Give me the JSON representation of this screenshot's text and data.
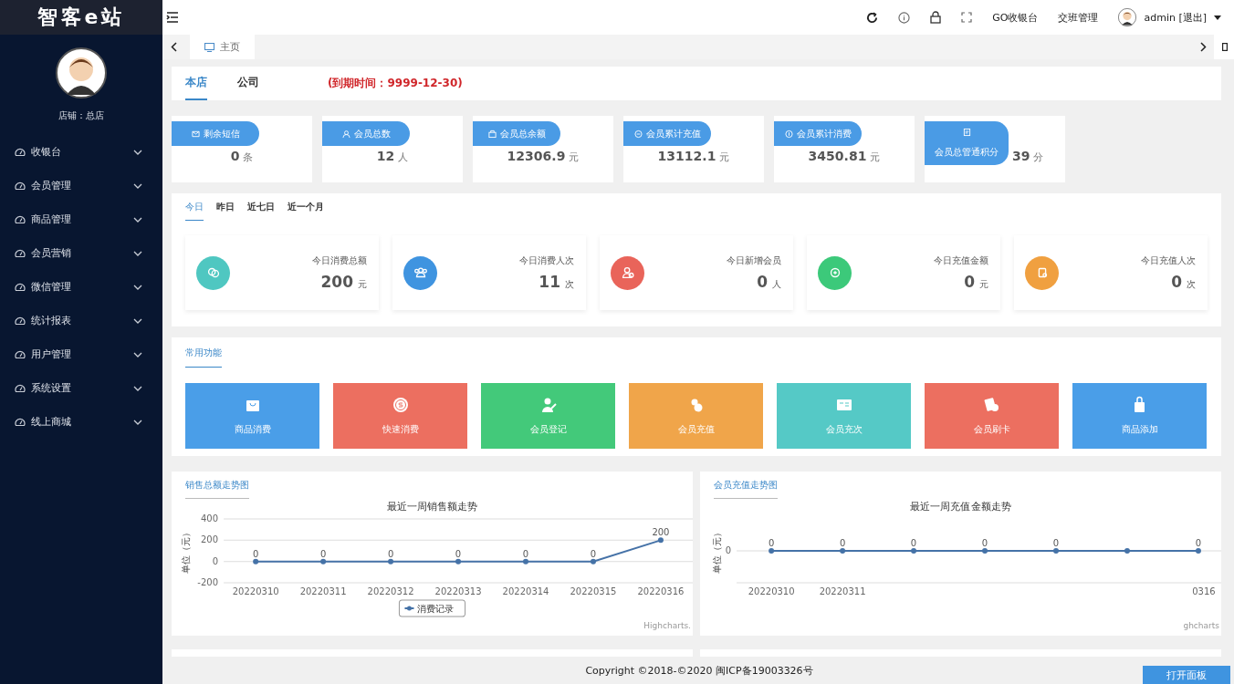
{
  "brand": {
    "title": "智客e站"
  },
  "sidebar": {
    "store_label": "店铺：总店",
    "items": [
      {
        "label": "收银台"
      },
      {
        "label": "会员管理"
      },
      {
        "label": "商品管理"
      },
      {
        "label": "会员营销"
      },
      {
        "label": "微信管理"
      },
      {
        "label": "统计报表"
      },
      {
        "label": "用户管理"
      },
      {
        "label": "系统设置"
      },
      {
        "label": "线上商城"
      }
    ]
  },
  "topbar": {
    "links": [
      "GO收银台",
      "交班管理"
    ],
    "user": "admin [退出]"
  },
  "tabs": [
    {
      "label": "主页",
      "selected": true
    }
  ],
  "store_tabs": {
    "tabs": [
      {
        "label": "本店",
        "selected": true
      },
      {
        "label": "公司",
        "selected": false
      }
    ],
    "expiry": "(到期时间：9999-12-30)"
  },
  "summary_cards": [
    {
      "label": "剩余短信",
      "value": "0",
      "unit": "条"
    },
    {
      "label": "会员总数",
      "value": "12",
      "unit": "人"
    },
    {
      "label": "会员总余额",
      "value": "12306.9",
      "unit": "元"
    },
    {
      "label": "会员累计充值",
      "value": "13112.1",
      "unit": "元"
    },
    {
      "label": "会员累计消费",
      "value": "3450.81",
      "unit": "元"
    },
    {
      "label": "会员总管通积分",
      "value": "39",
      "unit": "分"
    }
  ],
  "period_tabs": [
    {
      "label": "今日",
      "selected": true
    },
    {
      "label": "昨日",
      "selected": false
    },
    {
      "label": "近七日",
      "selected": false
    },
    {
      "label": "近一个月",
      "selected": false
    }
  ],
  "today_stats": [
    {
      "label": "今日消费总额",
      "value": "200",
      "unit": "元",
      "color": "#4fc7c1"
    },
    {
      "label": "今日消费人次",
      "value": "11",
      "unit": "次",
      "color": "#3f94e0"
    },
    {
      "label": "今日新增会员",
      "value": "0",
      "unit": "人",
      "color": "#e9645a"
    },
    {
      "label": "今日充值金额",
      "value": "0",
      "unit": "元",
      "color": "#3cc97a"
    },
    {
      "label": "今日充值人次",
      "value": "0",
      "unit": "次",
      "color": "#f0a040"
    }
  ],
  "shortcuts": {
    "title": "常用功能",
    "items": [
      {
        "label": "商品消费",
        "color": "#4a9ee8"
      },
      {
        "label": "快速消费",
        "color": "#ec6f60"
      },
      {
        "label": "会员登记",
        "color": "#43c97a"
      },
      {
        "label": "会员充值",
        "color": "#f0a54a"
      },
      {
        "label": "会员充次",
        "color": "#55c9c6"
      },
      {
        "label": "会员刷卡",
        "color": "#ec6f60"
      },
      {
        "label": "商品添加",
        "color": "#4a9ee8"
      }
    ]
  },
  "charts": [
    {
      "panel_title": "销售总额走势图",
      "credits": "Highcharts.",
      "chart_data": {
        "type": "line",
        "title": "最近一周销售额走势",
        "ylabel": "单位（元）",
        "categories": [
          "20220310",
          "20220311",
          "20220312",
          "20220313",
          "20220314",
          "20220315",
          "20220316"
        ],
        "ylim": [
          -200,
          400
        ],
        "yticks": [
          -200,
          0,
          200,
          400
        ],
        "data_labels": true,
        "series": [
          {
            "name": "消费记录",
            "color": "#4572a7",
            "marker": "circle",
            "values": [
              0,
              0,
              0,
              0,
              0,
              0,
              200
            ]
          }
        ]
      }
    },
    {
      "panel_title": "会员充值走势图",
      "credits": "ghcharts",
      "trend": {
        "title": "最近一周充值金额走势",
        "ylabel": "单位（元）",
        "y_tick": "0",
        "x_labels": [
          "20220310",
          "20220311",
          "0316"
        ],
        "point_labels": [
          "0",
          "0",
          "0",
          "0",
          "0",
          "0"
        ]
      }
    }
  ],
  "footer": {
    "copyright": "Copyright ©2018-©2020 闽ICP备19003326号",
    "panel_button": "打开面板"
  }
}
